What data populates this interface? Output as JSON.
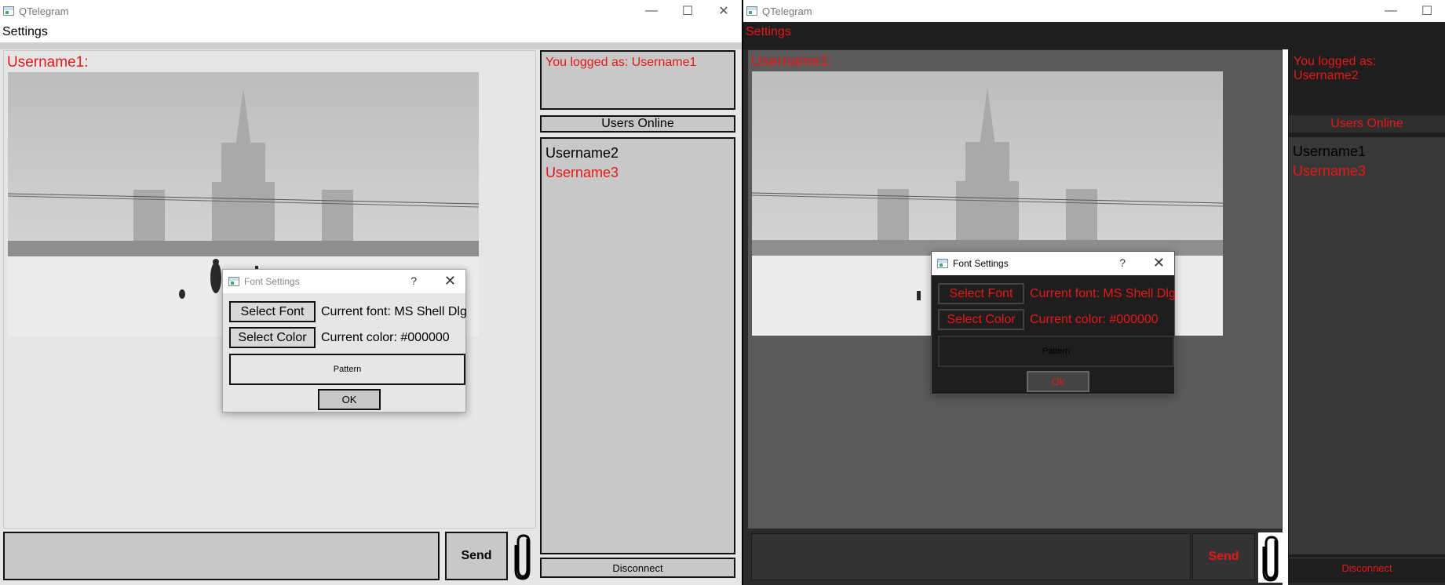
{
  "colors": {
    "accent_red": "#e81818",
    "light_bg": "#e6e6e6",
    "dark_bg": "#1e1e1e"
  },
  "windows": [
    {
      "title": "QTelegram",
      "menu": "Settings",
      "sender": "Username1:",
      "logged_as": "You logged as: Username1",
      "users_header": "Users Online",
      "users": [
        "Username2",
        "Username3"
      ],
      "send": "Send",
      "disconnect": "Disconnect",
      "dialog": {
        "title": "Font Settings",
        "help": "?",
        "select_font": "Select Font",
        "current_font": "Current font: MS Shell Dlg",
        "select_color": "Select Color",
        "current_color": "Current color: #000000",
        "pattern": "Pattern",
        "ok": "OK"
      }
    },
    {
      "title": "QTelegram",
      "menu": "Settings",
      "sender": "Username1:",
      "logged_as": "You logged as: Username2",
      "users_header": "Users Online",
      "users": [
        "Username1",
        "Username3"
      ],
      "send": "Send",
      "disconnect": "Disconnect",
      "dialog": {
        "title": "Font Settings",
        "help": "?",
        "select_font": "Select Font",
        "current_font": "Current font: MS Shell Dlg",
        "select_color": "Select Color",
        "current_color": "Current color: #000000",
        "pattern": "Pattern",
        "ok": "Ok"
      }
    }
  ]
}
